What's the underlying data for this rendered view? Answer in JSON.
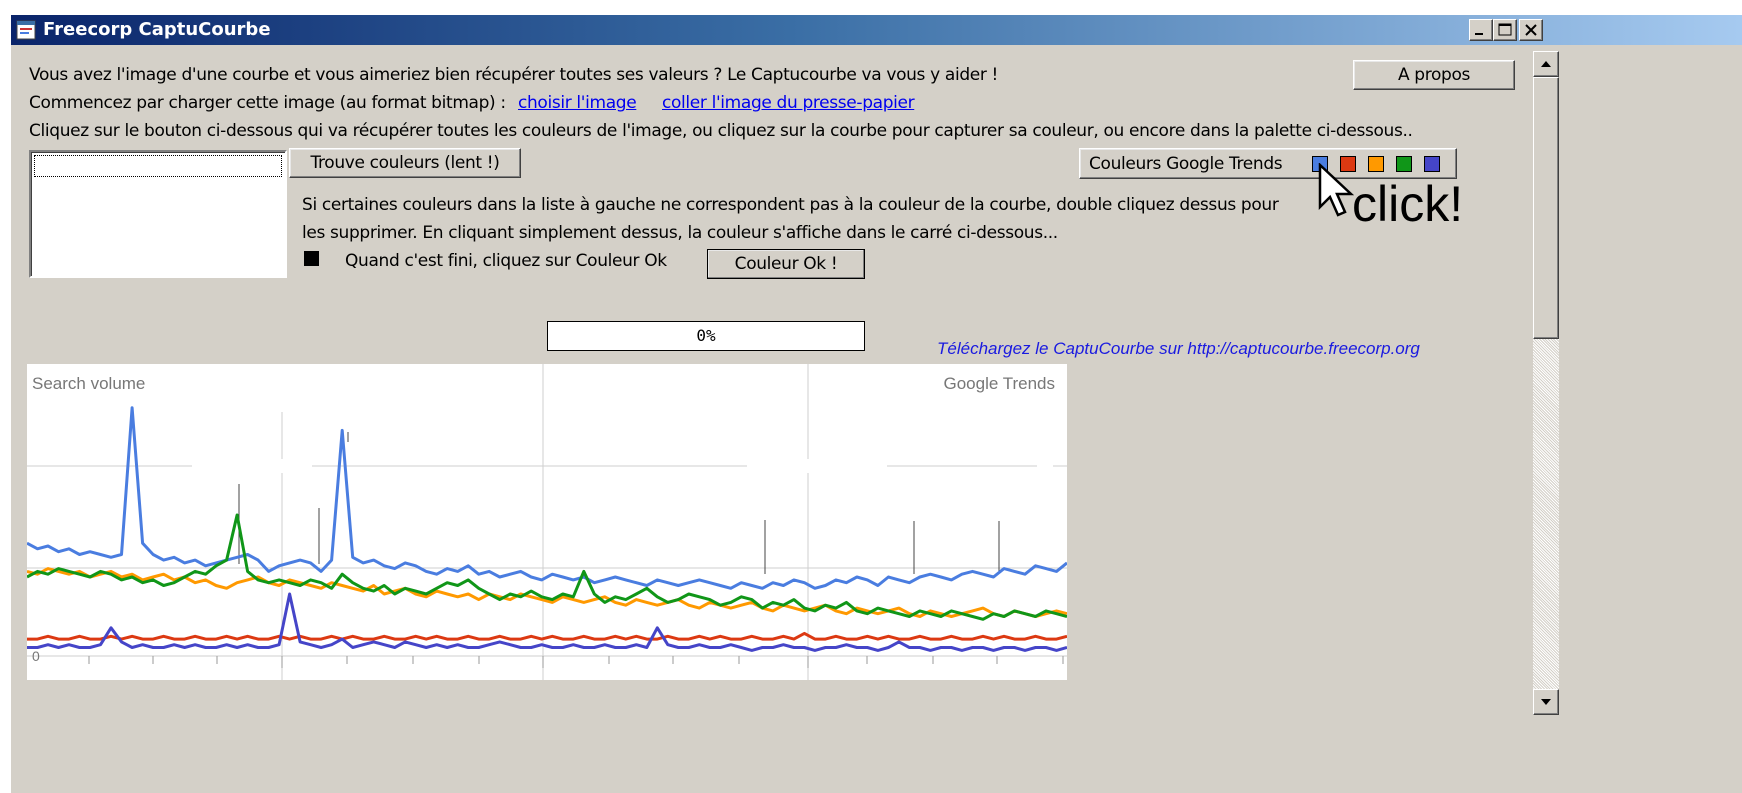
{
  "window": {
    "title": "Freecorp CaptuCourbe"
  },
  "intro": {
    "line1": "Vous avez l'image d'une courbe et vous aimeriez bien récupérer toutes ses valeurs ? Le Captucourbe va vous y aider !",
    "line2": "Commencez par charger cette image (au format bitmap) :",
    "link_choose": "choisir l'image",
    "link_paste": "coller l'image du presse-papier",
    "line3": "Cliquez sur le bouton ci-dessous qui va récupérer toutes les couleurs de l'image, ou cliquez sur la courbe pour capturer sa couleur, ou encore dans la palette ci-dessous.."
  },
  "buttons": {
    "about": "A propos",
    "find_colors": "Trouve couleurs (lent !)",
    "google_trends": "Couleurs Google Trends",
    "color_ok": "Couleur Ok !"
  },
  "palette": [
    {
      "name": "blue",
      "color": "#4a7de0"
    },
    {
      "name": "red",
      "color": "#dc3912"
    },
    {
      "name": "orange",
      "color": "#ff9900"
    },
    {
      "name": "green",
      "color": "#109618"
    },
    {
      "name": "purple",
      "color": "#4545c8"
    }
  ],
  "instructions": {
    "line1": "Si certaines couleurs dans la liste à gauche ne correspondent pas à la couleur de la courbe, double cliquez dessus pour",
    "line2": "les supprimer. En cliquant simplement dessus, la couleur s'affiche dans le carré ci-dessous...",
    "line3": "Quand c'est fini, cliquez sur Couleur Ok"
  },
  "progress": {
    "label": "0%",
    "value": 0
  },
  "download_text": "Téléchargez le CaptuCourbe sur http://captucourbe.freecorp.org",
  "annotation": "click!",
  "chart": {
    "label_left": "Search volume",
    "label_right": "Google Trends",
    "zero_label": "0"
  },
  "chart_data": {
    "type": "line",
    "xlim": [
      0,
      100
    ],
    "ylim": [
      0,
      100
    ],
    "series": [
      {
        "color": "#4a7de0",
        "values": [
          40,
          38,
          39,
          37,
          38,
          36,
          37,
          36,
          35,
          36,
          88,
          40,
          36,
          34,
          35,
          33,
          34,
          32,
          33,
          34,
          35,
          36,
          34,
          30,
          32,
          33,
          34,
          33,
          30,
          34,
          80,
          35,
          33,
          34,
          32,
          31,
          33,
          32,
          30,
          29,
          31,
          30,
          32,
          29,
          30,
          28,
          29,
          30,
          28,
          27,
          29,
          28,
          27,
          28,
          26,
          27,
          28,
          27,
          26,
          25,
          27,
          26,
          25,
          26,
          27,
          26,
          25,
          24,
          26,
          25,
          24,
          26,
          25,
          27,
          26,
          24,
          25,
          27,
          26,
          28,
          27,
          25,
          28,
          27,
          26,
          28,
          29,
          28,
          27,
          29,
          30,
          29,
          28,
          31,
          30,
          29,
          32,
          31,
          30,
          33
        ]
      },
      {
        "color": "#ff9900",
        "values": [
          30,
          29,
          31,
          30,
          29,
          30,
          28,
          29,
          30,
          28,
          29,
          27,
          28,
          29,
          27,
          28,
          26,
          27,
          25,
          24,
          26,
          27,
          28,
          26,
          25,
          27,
          26,
          25,
          24,
          26,
          25,
          24,
          23,
          25,
          22,
          23,
          24,
          22,
          21,
          23,
          22,
          21,
          22,
          20,
          22,
          21,
          20,
          22,
          21,
          20,
          19,
          21,
          20,
          19,
          20,
          21,
          19,
          18,
          20,
          19,
          18,
          19,
          20,
          18,
          17,
          19,
          18,
          17,
          18,
          19,
          17,
          16,
          18,
          17,
          16,
          17,
          18,
          16,
          15,
          17,
          16,
          15,
          16,
          17,
          15,
          14,
          16,
          15,
          14,
          15,
          16,
          17,
          15,
          14,
          16,
          15,
          14,
          15,
          16,
          15
        ]
      },
      {
        "color": "#109618",
        "values": [
          28,
          30,
          29,
          31,
          30,
          29,
          28,
          30,
          29,
          27,
          28,
          26,
          27,
          25,
          26,
          28,
          30,
          29,
          32,
          34,
          50,
          30,
          27,
          26,
          27,
          26,
          25,
          27,
          26,
          24,
          29,
          26,
          24,
          23,
          25,
          22,
          24,
          23,
          22,
          24,
          26,
          25,
          27,
          24,
          22,
          20,
          22,
          21,
          23,
          21,
          20,
          22,
          21,
          30,
          22,
          19,
          21,
          20,
          22,
          24,
          21,
          19,
          20,
          22,
          21,
          20,
          18,
          19,
          21,
          20,
          17,
          19,
          18,
          20,
          17,
          16,
          18,
          17,
          19,
          16,
          15,
          17,
          16,
          15,
          14,
          16,
          15,
          14,
          16,
          15,
          14,
          13,
          15,
          14,
          16,
          15,
          14,
          16,
          15,
          14
        ]
      },
      {
        "color": "#dc3912",
        "values": [
          6,
          6,
          7,
          6,
          6,
          7,
          6,
          6,
          7,
          6,
          7,
          6,
          6,
          7,
          6,
          6,
          7,
          6,
          6,
          7,
          6,
          7,
          6,
          6,
          7,
          6,
          7,
          6,
          6,
          7,
          6,
          7,
          6,
          6,
          7,
          6,
          6,
          7,
          6,
          7,
          6,
          6,
          7,
          6,
          6,
          7,
          6,
          6,
          7,
          6,
          7,
          6,
          6,
          7,
          6,
          6,
          7,
          6,
          7,
          6,
          6,
          7,
          6,
          6,
          7,
          6,
          7,
          6,
          6,
          7,
          6,
          6,
          7,
          6,
          8,
          6,
          6,
          7,
          6,
          6,
          7,
          6,
          7,
          6,
          6,
          7,
          6,
          6,
          7,
          6,
          6,
          7,
          6,
          7,
          6,
          6,
          7,
          6,
          6,
          7
        ]
      },
      {
        "color": "#4545c8",
        "values": [
          3,
          3,
          4,
          3,
          4,
          3,
          3,
          4,
          10,
          5,
          3,
          4,
          3,
          3,
          4,
          3,
          4,
          3,
          3,
          4,
          3,
          4,
          3,
          3,
          4,
          22,
          5,
          4,
          3,
          4,
          6,
          3,
          4,
          5,
          4,
          3,
          5,
          4,
          3,
          4,
          3,
          4,
          3,
          3,
          4,
          5,
          4,
          3,
          3,
          4,
          3,
          3,
          4,
          3,
          3,
          4,
          3,
          3,
          4,
          3,
          10,
          4,
          3,
          3,
          4,
          3,
          3,
          4,
          3,
          2,
          3,
          3,
          4,
          3,
          3,
          2,
          3,
          3,
          4,
          3,
          3,
          2,
          3,
          5,
          3,
          3,
          2,
          3,
          3,
          2,
          3,
          3,
          2,
          3,
          3,
          2,
          3,
          3,
          2,
          3
        ]
      }
    ]
  }
}
